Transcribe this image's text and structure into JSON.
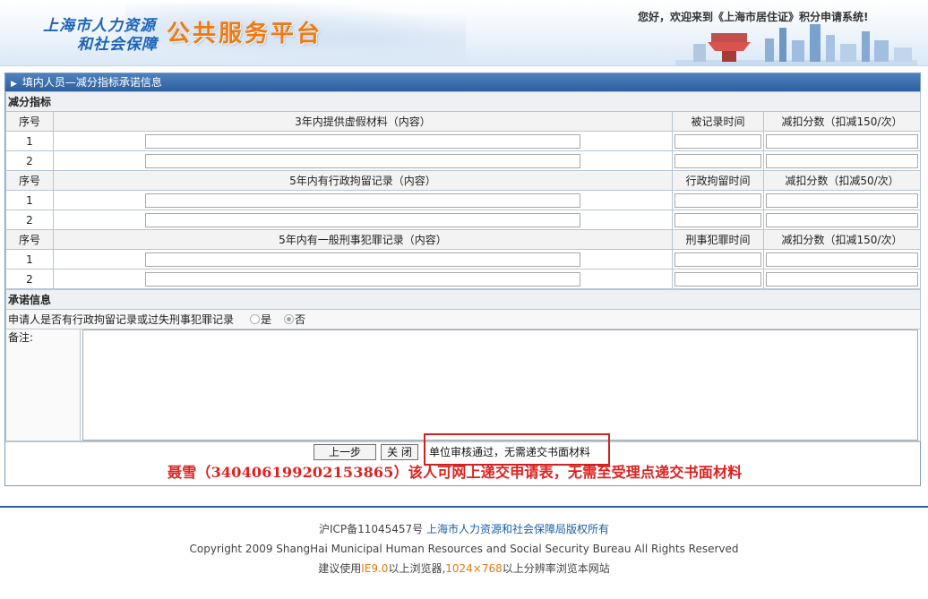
{
  "header": {
    "logo_line1": "上海市人力资源",
    "logo_line2": "和社会保障",
    "logo_main": "公共服务平台",
    "welcome": "您好，欢迎来到《上海市居住证》积分申请系统!"
  },
  "panel": {
    "title": "填内人员—减分指标承诺信息"
  },
  "deduction": {
    "section_title": "减分指标",
    "groups": [
      {
        "seq_header": "序号",
        "content_header": "3年内提供虚假材料（内容）",
        "time_header": "被记录时间",
        "score_header": "减扣分数（扣减150/次）",
        "rows": [
          "1",
          "2"
        ]
      },
      {
        "seq_header": "序号",
        "content_header": "5年内有行政拘留记录（内容）",
        "time_header": "行政拘留时间",
        "score_header": "减扣分数（扣减50/次）",
        "rows": [
          "1",
          "2"
        ]
      },
      {
        "seq_header": "序号",
        "content_header": "5年内有一般刑事犯罪记录（内容）",
        "time_header": "刑事犯罪时间",
        "score_header": "减扣分数（扣减150/次）",
        "rows": [
          "1",
          "2"
        ]
      }
    ]
  },
  "commitment": {
    "section_title": "承诺信息",
    "question": "申请人是否有行政拘留记录或过失刑事犯罪记录",
    "option_yes": "是",
    "option_no": "否",
    "selected": "否",
    "remark_label": "备注:",
    "remark_value": ""
  },
  "actions": {
    "prev_label": "上一步",
    "close_label": "关 闭",
    "status_text": "单位审核通过，无需递交书面材料",
    "red_note": "聂雪（340406199202153865）该人可网上递交申请表，无需至受理点递交书面材料"
  },
  "footer": {
    "icp": "沪ICP备11045457号",
    "copyright_owner": "上海市人力资源和社会保障局版权所有",
    "copyright": "Copyright 2009 ShangHai Municipal Human Resources and Social Security Bureau All Rights Reserved",
    "browser_pre": "建议使用",
    "browser_ie": "IE9.0",
    "browser_mid": "以上浏览器,",
    "browser_res": "1024×768",
    "browser_post": "以上分辨率浏览本网站"
  },
  "colors": {
    "title_bar": "#2b5f9f",
    "logo_blue": "#1b64b8",
    "logo_orange": "#f07a10",
    "highlight_red": "#cc2222",
    "note_red": "#e0201e"
  }
}
